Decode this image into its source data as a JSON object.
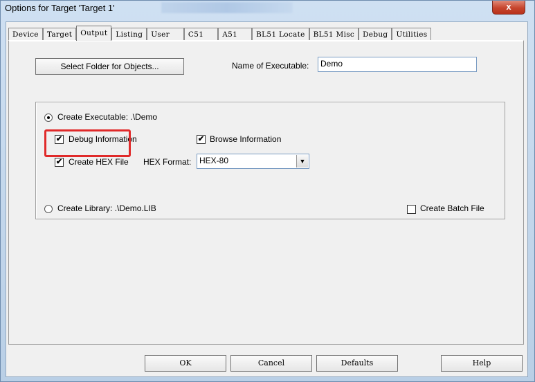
{
  "window": {
    "title": "Options for Target 'Target 1'",
    "close_glyph": "x"
  },
  "tabs": [
    {
      "label": "Device"
    },
    {
      "label": "Target"
    },
    {
      "label": "Output"
    },
    {
      "label": "Listing"
    },
    {
      "label": "User"
    },
    {
      "label": "C51"
    },
    {
      "label": "A51"
    },
    {
      "label": "BL51 Locate"
    },
    {
      "label": "BL51 Misc"
    },
    {
      "label": "Debug"
    },
    {
      "label": "Utilities"
    }
  ],
  "active_tab": "Output",
  "output": {
    "select_folder_label": "Select Folder for Objects...",
    "name_exe_label": "Name of Executable:",
    "name_exe_value": "Demo",
    "create_exe_label": "Create Executable: .\\Demo",
    "create_exe_selected": true,
    "debug_info_label": "Debug Information",
    "debug_info_checked": true,
    "browse_info_label": "Browse Information",
    "browse_info_checked": true,
    "create_hex_label": "Create HEX File",
    "create_hex_checked": true,
    "hex_format_label": "HEX Format:",
    "hex_format_value": "HEX-80",
    "create_lib_label": "Create Library: .\\Demo.LIB",
    "create_lib_selected": false,
    "create_batch_label": "Create Batch File",
    "create_batch_checked": false
  },
  "footer": {
    "ok": "OK",
    "cancel": "Cancel",
    "defaults": "Defaults",
    "help": "Help"
  },
  "colors": {
    "highlight": "#e02a2a",
    "close": "#c7452d"
  }
}
